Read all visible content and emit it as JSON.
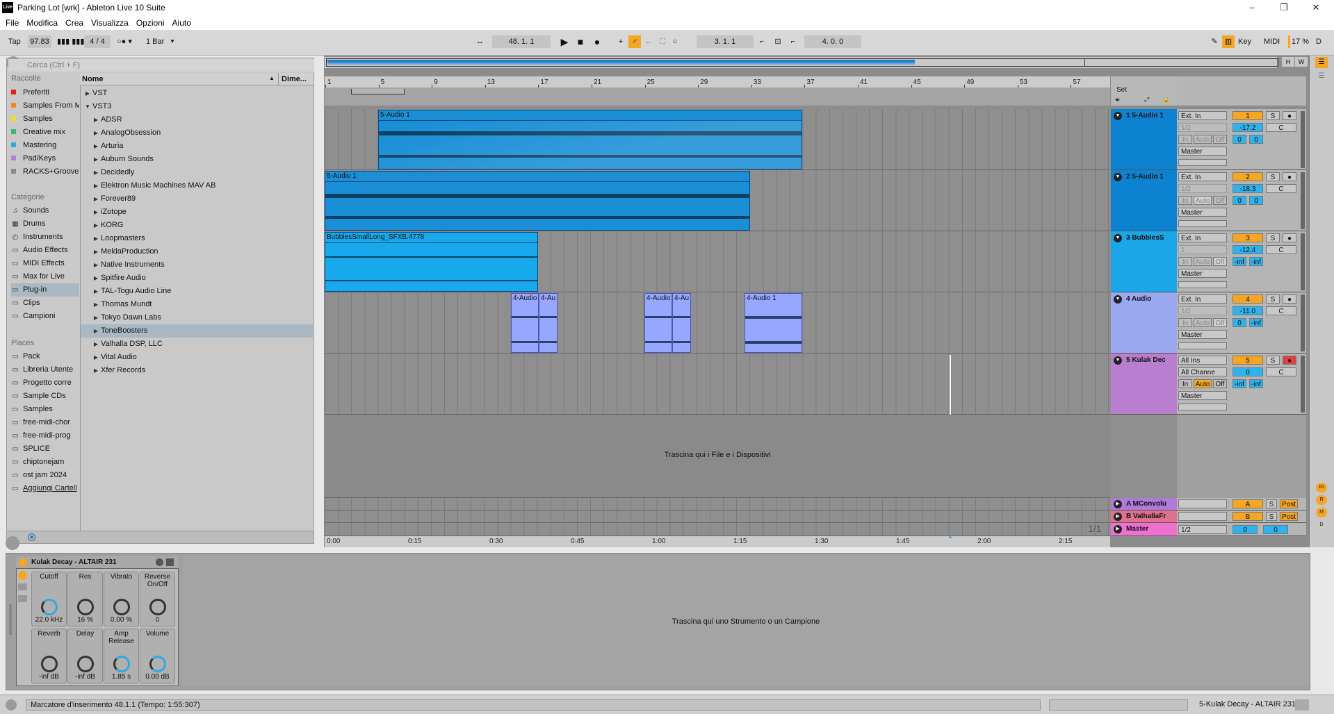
{
  "window": {
    "title": "Parking Lot  [wrk] - Ableton Live 10 Suite",
    "logo": "Live",
    "minimize": "–",
    "maximize": "❐",
    "close": "✕"
  },
  "menu": [
    "File",
    "Modifica",
    "Crea",
    "Visualizza",
    "Opzioni",
    "Aiuto"
  ],
  "transport": {
    "tap": "Tap",
    "tempo": "97.83",
    "time_sig": "4 / 4",
    "quant": "1 Bar",
    "position": "48.  1.  1",
    "loop_start": "3.  1.  1",
    "loop_len": "4.  0.  0",
    "key": "Key",
    "midi": "MIDI",
    "cpu": "17 %",
    "d": "D",
    "h": "H",
    "w": "W"
  },
  "browser": {
    "search_placeholder": "Cerca (Ctrl + F)",
    "collections_title": "Raccolte",
    "collections": [
      {
        "label": "Preferiti",
        "color": "#e02020"
      },
      {
        "label": "Samples From M",
        "color": "#f08a20"
      },
      {
        "label": "Samples",
        "color": "#f2e020"
      },
      {
        "label": "Creative mix",
        "color": "#30c060"
      },
      {
        "label": "Mastering",
        "color": "#30a8e0"
      },
      {
        "label": "Pad/Keys",
        "color": "#b080e0"
      },
      {
        "label": "RACKS+Groove",
        "color": "#8a8a8a"
      }
    ],
    "categories_title": "Categorie",
    "categories": [
      "Sounds",
      "Drums",
      "Instruments",
      "Audio Effects",
      "MIDI Effects",
      "Max for Live",
      "Plug-in",
      "Clips",
      "Campioni"
    ],
    "places_title": "Places",
    "places": [
      "Pack",
      "Libreria Utente",
      "Progetto corre",
      "Sample CDs",
      "Samples",
      "free-midi-chor",
      "free-midi-prog",
      "SPLICE",
      "chiptonejam",
      "ost jam 2024",
      "Aggiungi Cartell"
    ],
    "col_name": "Nome",
    "col_dim": "Dime...",
    "items": [
      {
        "label": "VST",
        "lvl": 0,
        "arrow": "▶"
      },
      {
        "label": "VST3",
        "lvl": 0,
        "arrow": "▼"
      },
      {
        "label": "ADSR",
        "lvl": 1,
        "arrow": "▶"
      },
      {
        "label": "AnalogObsession",
        "lvl": 1,
        "arrow": "▶"
      },
      {
        "label": "Arturia",
        "lvl": 1,
        "arrow": "▶"
      },
      {
        "label": "Auburn Sounds",
        "lvl": 1,
        "arrow": "▶"
      },
      {
        "label": "Decidedly",
        "lvl": 1,
        "arrow": "▶"
      },
      {
        "label": "Elektron Music Machines MAV AB",
        "lvl": 1,
        "arrow": "▶"
      },
      {
        "label": "Forever89",
        "lvl": 1,
        "arrow": "▶"
      },
      {
        "label": "iZotope",
        "lvl": 1,
        "arrow": "▶"
      },
      {
        "label": "KORG",
        "lvl": 1,
        "arrow": "▶"
      },
      {
        "label": "Loopmasters",
        "lvl": 1,
        "arrow": "▶"
      },
      {
        "label": "MeldaProduction",
        "lvl": 1,
        "arrow": "▶"
      },
      {
        "label": "Native Instruments",
        "lvl": 1,
        "arrow": "▶"
      },
      {
        "label": "Spitfire Audio",
        "lvl": 1,
        "arrow": "▶"
      },
      {
        "label": "TAL-Togu Audio Line",
        "lvl": 1,
        "arrow": "▶"
      },
      {
        "label": "Thomas Mundt",
        "lvl": 1,
        "arrow": "▶"
      },
      {
        "label": "Tokyo Dawn Labs",
        "lvl": 1,
        "arrow": "▶"
      },
      {
        "label": "ToneBoosters",
        "lvl": 1,
        "arrow": "▶"
      },
      {
        "label": "Valhalla DSP, LLC",
        "lvl": 1,
        "arrow": "▶"
      },
      {
        "label": "Vital Audio",
        "lvl": 1,
        "arrow": "▶"
      },
      {
        "label": "Xfer Records",
        "lvl": 1,
        "arrow": "▶"
      }
    ]
  },
  "ruler_bars": [
    "1",
    "5",
    "9",
    "13",
    "17",
    "21",
    "25",
    "29",
    "33",
    "37",
    "41",
    "45",
    "49",
    "53",
    "57"
  ],
  "time_marks": [
    "0:00",
    "0:15",
    "0:30",
    "0:45",
    "1:00",
    "1:15",
    "1:30",
    "1:45",
    "2:00",
    "2:15"
  ],
  "set_label": "Set",
  "page_count": "1/1",
  "tracks": [
    {
      "name": "1 5-Audio 1",
      "color": "#0d82d0",
      "input": "Ext. In",
      "chan": "1/2",
      "out": "Master",
      "num": "1",
      "vol": "-17.2",
      "pan": "C",
      "s1": "0",
      "s2": "0",
      "in": "In",
      "auto": "Auto",
      "off": "Off"
    },
    {
      "name": "2 5-Audio 1",
      "color": "#0d82d0",
      "input": "Ext. In",
      "chan": "1/2",
      "out": "Master",
      "num": "2",
      "vol": "-18.3",
      "pan": "C",
      "s1": "0",
      "s2": "0",
      "in": "In",
      "auto": "Auto",
      "off": "Off"
    },
    {
      "name": "3 BubblesS",
      "color": "#1aa6e8",
      "input": "Ext. In",
      "chan": "1",
      "out": "Master",
      "num": "3",
      "vol": "-12.4",
      "pan": "C",
      "s1": "-inf",
      "s2": "-inf",
      "in": "In",
      "auto": "Auto",
      "off": "Off"
    },
    {
      "name": "4 Audio",
      "color": "#9aa8f0",
      "input": "Ext. In",
      "chan": "1/2",
      "out": "Master",
      "num": "4",
      "vol": "-11.0",
      "pan": "C",
      "s1": "0",
      "s2": "-inf",
      "in": "In",
      "auto": "Auto",
      "off": "Off"
    },
    {
      "name": "5 Kulak Dec",
      "color": "#b97ed0",
      "input": "All Ins",
      "chan": "All Channe",
      "out": "Master",
      "num": "5",
      "vol": "0",
      "pan": "C",
      "s1": "-inf",
      "s2": "-inf",
      "in": "In",
      "auto": "Auto",
      "off": "Off"
    }
  ],
  "clips": {
    "c1": "5-Audio 1",
    "c2": "5-Audio 1",
    "c3": "BubblesSmallLong_SFXB.4778",
    "c4a": "4-Audio",
    "c4b": "4-Au",
    "c4c": "4-Audio",
    "c4d": "4-Au",
    "c4e": "4-Audio 1"
  },
  "drop_arrangement": "Trascina qui i File e i Dispositivi",
  "returns": [
    {
      "name": "A MConvolu",
      "color": "#b07ad8",
      "letter": "A",
      "s": "S",
      "post": "Post"
    },
    {
      "name": "B ValhallaFr",
      "color": "#e07090",
      "letter": "B",
      "s": "S",
      "post": "Post"
    }
  ],
  "master": {
    "name": "Master",
    "color": "#f070d0",
    "chan": "1/2",
    "v1": "0",
    "v2": "0"
  },
  "device": {
    "title": "Kulak Decay - ALTAIR 231",
    "knobs": [
      {
        "label": "Cutoff",
        "value": "22.0 kHz"
      },
      {
        "label": "Res",
        "value": "16 %"
      },
      {
        "label": "Vibrato",
        "value": "0.00 %"
      },
      {
        "label": "Reverse On/Off",
        "value": "0"
      },
      {
        "label": "Reverb",
        "value": "-inf dB"
      },
      {
        "label": "Delay",
        "value": "-inf dB"
      },
      {
        "label": "Amp Release",
        "value": "1.85 s"
      },
      {
        "label": "Volume",
        "value": "0.00 dB"
      }
    ]
  },
  "drop_device": "Trascina qui uno Strumento o un Campione",
  "status": {
    "text": "Marcatore d'inserimento 48.1.1 (Tempo: 1:55:307)",
    "right": "5-Kulak Decay - ALTAIR 231"
  },
  "side_labels": [
    "IO",
    "R",
    "M",
    "D"
  ]
}
